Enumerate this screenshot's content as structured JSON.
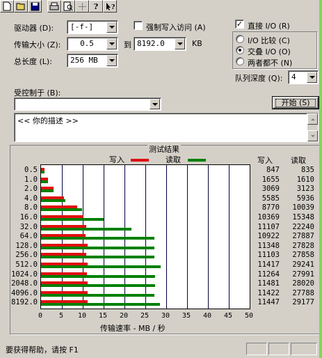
{
  "toolbar": {
    "icons": [
      "new-icon",
      "open-icon",
      "save-icon",
      "print-icon",
      "print-preview-icon",
      "move-icon",
      "help-icon",
      "context-help-icon"
    ]
  },
  "form": {
    "drive_label": "驱动器 (D):",
    "drive_value": "[-f-]",
    "force_write_label": "强制写入访问 (A)",
    "transfer_size_label": "传输大小 (Z):",
    "transfer_from": "0.5",
    "to_label": "到",
    "transfer_to": "8192.0",
    "transfer_unit": "KB",
    "total_length_label": "总长度 (L):",
    "total_length_value": "256 MB",
    "controlled_by_label": "受控制于 (B):",
    "controlled_by_value": "",
    "description_placeholder": "<<   你的描述   >>",
    "start_button": "开始 (S)"
  },
  "io_options": {
    "direct_io_label": "直接 I/O (R)",
    "direct_io_checked": true,
    "compare_label": "I/O 比较 (C)",
    "overlap_label": "交叠 I/O (O)",
    "neither_label": "两者都不 (N)",
    "selected": "overlap",
    "queue_depth_label": "队列深度 (Q):",
    "queue_depth_value": "4"
  },
  "results": {
    "title": "测试结果",
    "legend_write": "写入",
    "legend_read": "读取",
    "col_write": "写入",
    "col_read": "读取",
    "write_color": "#e01010",
    "read_color": "#008000",
    "xlabel": "传输速率 - MB / 秒"
  },
  "chart_data": {
    "type": "bar",
    "orientation": "horizontal",
    "xlabel": "传输速率 - MB / 秒",
    "xlim": [
      0,
      50
    ],
    "xticks": [
      0,
      5,
      10,
      15,
      20,
      25,
      30,
      35,
      40,
      45,
      50
    ],
    "categories": [
      "0.5",
      "1.0",
      "2.0",
      "4.0",
      "8.0",
      "16.0",
      "32.0",
      "64.0",
      "128.0",
      "256.0",
      "512.0",
      "1024.0",
      "2048.0",
      "4096.0",
      "8192.0"
    ],
    "series": [
      {
        "name": "写入",
        "values_mb": [
          0.8,
          1.6,
          3.0,
          5.5,
          8.6,
          10.1,
          10.8,
          10.7,
          11.1,
          10.8,
          11.1,
          11.0,
          11.2,
          11.2,
          11.2
        ],
        "labels": [
          847,
          1655,
          3069,
          5585,
          8770,
          10369,
          11107,
          10922,
          11348,
          11103,
          11417,
          11264,
          11481,
          11422,
          11447
        ]
      },
      {
        "name": "读取",
        "values_mb": [
          0.8,
          1.6,
          3.0,
          5.8,
          9.8,
          15.0,
          21.7,
          27.2,
          27.2,
          27.2,
          28.6,
          27.3,
          27.4,
          27.1,
          28.5
        ],
        "labels": [
          835,
          1610,
          3123,
          5936,
          10039,
          15348,
          22240,
          27887,
          27828,
          27858,
          29241,
          27991,
          28020,
          27788,
          29177
        ]
      }
    ]
  },
  "status": {
    "text": "要获得帮助，请按 F1"
  }
}
